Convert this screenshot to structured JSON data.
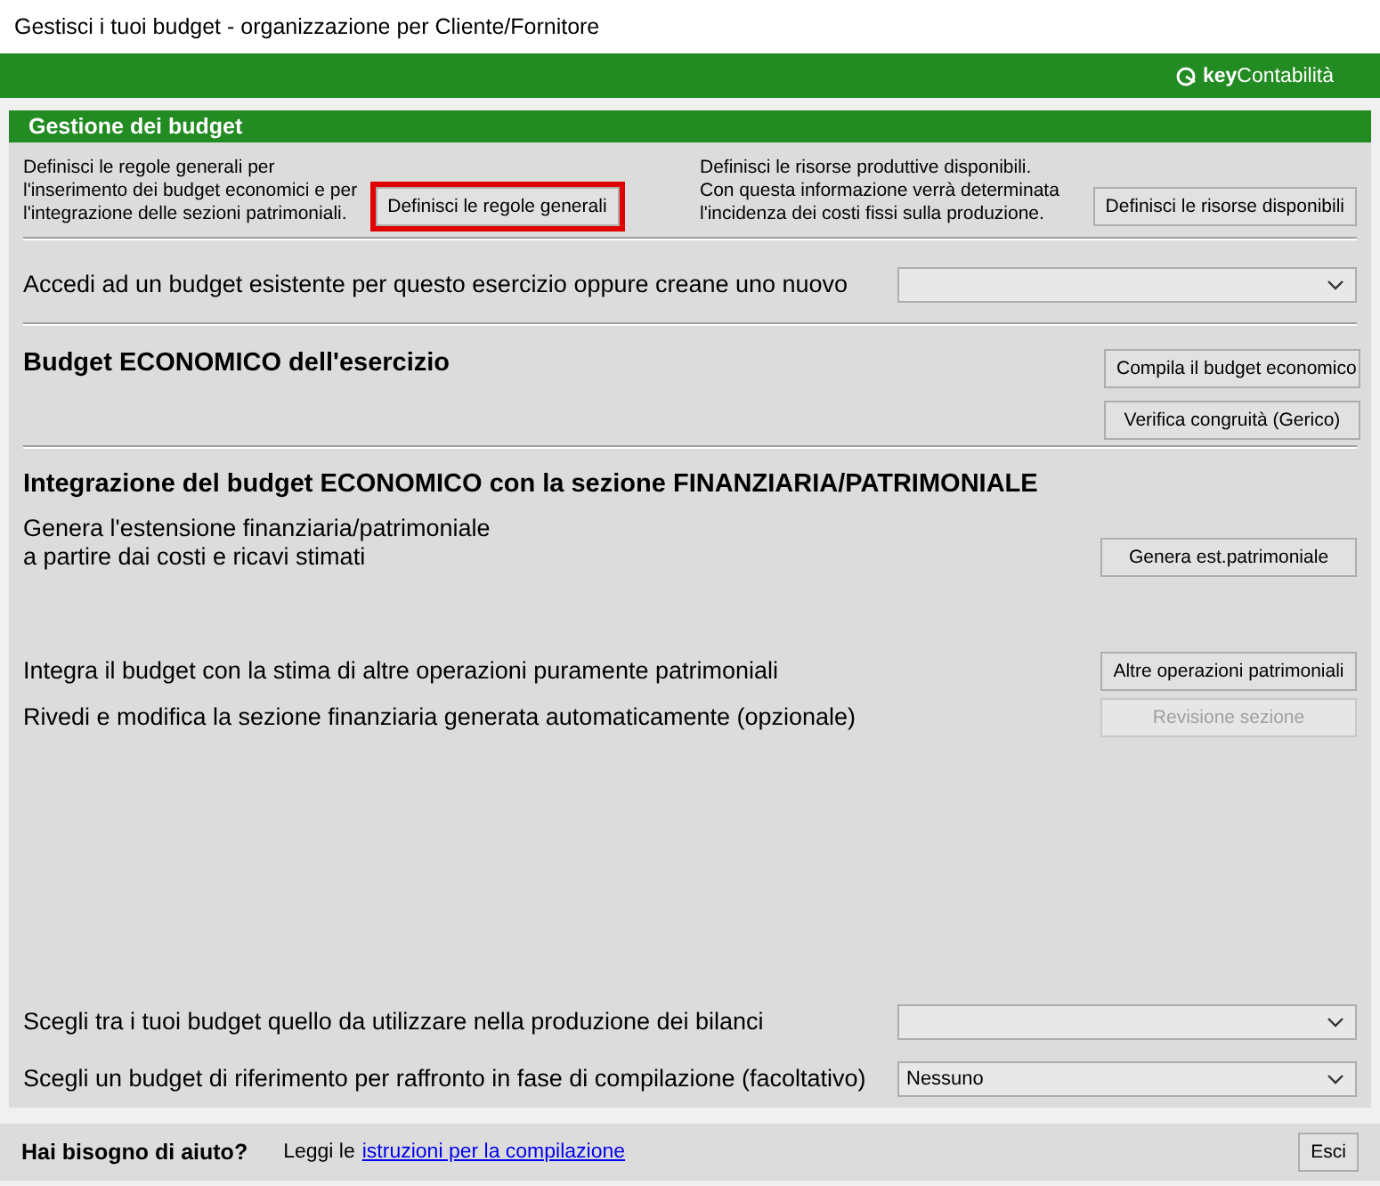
{
  "window": {
    "title": "Gestisci i tuoi budget - organizzazione per Cliente/Fornitore"
  },
  "brand": {
    "bold": "key",
    "regular": "Contabilità"
  },
  "panel": {
    "title": "Gestione dei budget"
  },
  "intro": [
    {
      "text": "Definisci le regole generali per\nl'inserimento dei budget economici e per\nl'integrazione delle sezioni patrimoniali.",
      "button": {
        "label": "Definisci le regole generali",
        "highlighted": true,
        "disabled": false
      }
    },
    {
      "text": "Definisci le risorse produttive disponibili.\nCon questa informazione verrà determinata\nl'incidenza dei costi fissi sulla produzione.",
      "button": {
        "label": "Definisci le risorse disponibili",
        "highlighted": false,
        "disabled": false
      }
    }
  ],
  "access": {
    "label": "Accedi ad un budget esistente per questo esercizio oppure creane uno nuovo"
  },
  "economic": {
    "title": "Budget ECONOMICO dell'esercizio",
    "buttons": [
      {
        "label": "Compila il budget economico",
        "highlighted": false,
        "disabled": false
      },
      {
        "label": "Verifica congruità (Gerico)",
        "highlighted": false,
        "disabled": false
      }
    ]
  },
  "integration": {
    "title": "Integrazione del budget ECONOMICO con la sezione FINANZIARIA/PATRIMONIALE",
    "rows": [
      {
        "text": "Genera l'estensione finanziaria/patrimoniale\na partire dai costi e ricavi stimati",
        "button": {
          "label": "Genera est.patrimoniale",
          "highlighted": false,
          "disabled": false
        }
      },
      {
        "text": "Integra il budget con la stima di altre operazioni puramente patrimoniali",
        "button": {
          "label": "Altre operazioni patrimoniali",
          "highlighted": false,
          "disabled": false
        }
      },
      {
        "text": "Rivedi e modifica la sezione finanziaria generata automaticamente (opzionale)",
        "button": {
          "label": "Revisione sezione",
          "highlighted": false,
          "disabled": true
        }
      }
    ]
  },
  "selects": [
    {
      "label": "Scegli tra i tuoi budget quello da utilizzare nella produzione dei bilanci"
    },
    {
      "label": "Scegli un budget di riferimento per raffronto in fase di compilazione (facoltativo)",
      "value": "Nessuno"
    }
  ],
  "footer": {
    "question": "Hai bisogno di aiuto?",
    "prefix": "Leggi le",
    "link": "istruzioni per la compilazione",
    "button": {
      "label": "Esci",
      "highlighted": false,
      "disabled": false
    }
  }
}
